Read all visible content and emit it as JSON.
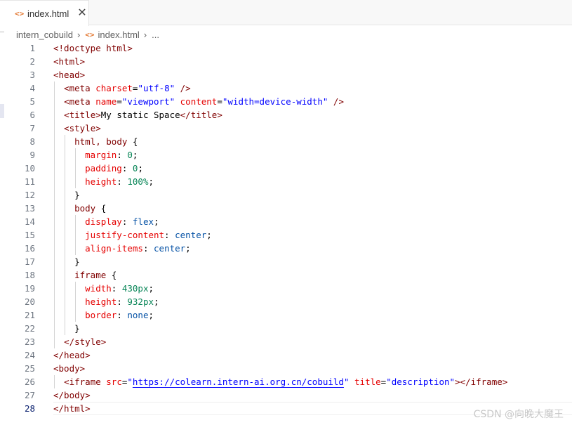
{
  "tab": {
    "icon": "<>",
    "label": "index.html",
    "close": "✕"
  },
  "breadcrumb": {
    "folder": "intern_cobuild",
    "separator": "›",
    "file_icon": "<>",
    "file": "index.html",
    "ellipsis": "..."
  },
  "editor": {
    "current_line": 28,
    "lines": [
      {
        "num": "1",
        "tokens": [
          [
            "tag",
            "<!doctype html>"
          ]
        ]
      },
      {
        "num": "2",
        "tokens": [
          [
            "tag",
            "<html>"
          ]
        ]
      },
      {
        "num": "3",
        "tokens": [
          [
            "tag",
            "<head>"
          ]
        ]
      },
      {
        "num": "4",
        "tokens": [
          [
            "txt",
            "  "
          ],
          [
            "tag",
            "<meta "
          ],
          [
            "attr",
            "charset"
          ],
          [
            "txt",
            "="
          ],
          [
            "str",
            "\"utf-8\""
          ],
          [
            "tag",
            " />"
          ]
        ]
      },
      {
        "num": "5",
        "tokens": [
          [
            "txt",
            "  "
          ],
          [
            "tag",
            "<meta "
          ],
          [
            "attr",
            "name"
          ],
          [
            "txt",
            "="
          ],
          [
            "str",
            "\"viewport\""
          ],
          [
            "txt",
            " "
          ],
          [
            "attr",
            "content"
          ],
          [
            "txt",
            "="
          ],
          [
            "str",
            "\"width=device-width\""
          ],
          [
            "tag",
            " />"
          ]
        ]
      },
      {
        "num": "6",
        "tokens": [
          [
            "txt",
            "  "
          ],
          [
            "tag",
            "<title>"
          ],
          [
            "txt",
            "My static Space"
          ],
          [
            "tag",
            "</title>"
          ]
        ]
      },
      {
        "num": "7",
        "tokens": [
          [
            "txt",
            "  "
          ],
          [
            "tag",
            "<style>"
          ]
        ]
      },
      {
        "num": "8",
        "tokens": [
          [
            "txt",
            "    "
          ],
          [
            "sel",
            "html, body "
          ],
          [
            "txt",
            "{"
          ]
        ]
      },
      {
        "num": "9",
        "tokens": [
          [
            "txt",
            "      "
          ],
          [
            "prop",
            "margin"
          ],
          [
            "txt",
            ": "
          ],
          [
            "num",
            "0"
          ],
          [
            "txt",
            ";"
          ]
        ]
      },
      {
        "num": "10",
        "tokens": [
          [
            "txt",
            "      "
          ],
          [
            "prop",
            "padding"
          ],
          [
            "txt",
            ": "
          ],
          [
            "num",
            "0"
          ],
          [
            "txt",
            ";"
          ]
        ]
      },
      {
        "num": "11",
        "tokens": [
          [
            "txt",
            "      "
          ],
          [
            "prop",
            "height"
          ],
          [
            "txt",
            ": "
          ],
          [
            "num",
            "100%"
          ],
          [
            "txt",
            ";"
          ]
        ]
      },
      {
        "num": "12",
        "tokens": [
          [
            "txt",
            "    "
          ],
          [
            "txt",
            "}"
          ]
        ]
      },
      {
        "num": "13",
        "tokens": [
          [
            "txt",
            "    "
          ],
          [
            "sel",
            "body "
          ],
          [
            "txt",
            "{"
          ]
        ]
      },
      {
        "num": "14",
        "tokens": [
          [
            "txt",
            "      "
          ],
          [
            "prop",
            "display"
          ],
          [
            "txt",
            ": "
          ],
          [
            "val",
            "flex"
          ],
          [
            "txt",
            ";"
          ]
        ]
      },
      {
        "num": "15",
        "tokens": [
          [
            "txt",
            "      "
          ],
          [
            "prop",
            "justify-content"
          ],
          [
            "txt",
            ": "
          ],
          [
            "val",
            "center"
          ],
          [
            "txt",
            ";"
          ]
        ]
      },
      {
        "num": "16",
        "tokens": [
          [
            "txt",
            "      "
          ],
          [
            "prop",
            "align-items"
          ],
          [
            "txt",
            ": "
          ],
          [
            "val",
            "center"
          ],
          [
            "txt",
            ";"
          ]
        ]
      },
      {
        "num": "17",
        "tokens": [
          [
            "txt",
            "    "
          ],
          [
            "txt",
            "}"
          ]
        ]
      },
      {
        "num": "18",
        "tokens": [
          [
            "txt",
            "    "
          ],
          [
            "sel",
            "iframe "
          ],
          [
            "txt",
            "{"
          ]
        ]
      },
      {
        "num": "19",
        "tokens": [
          [
            "txt",
            "      "
          ],
          [
            "prop",
            "width"
          ],
          [
            "txt",
            ": "
          ],
          [
            "num",
            "430px"
          ],
          [
            "txt",
            ";"
          ]
        ]
      },
      {
        "num": "20",
        "tokens": [
          [
            "txt",
            "      "
          ],
          [
            "prop",
            "height"
          ],
          [
            "txt",
            ": "
          ],
          [
            "num",
            "932px"
          ],
          [
            "txt",
            ";"
          ]
        ]
      },
      {
        "num": "21",
        "tokens": [
          [
            "txt",
            "      "
          ],
          [
            "prop",
            "border"
          ],
          [
            "txt",
            ": "
          ],
          [
            "val",
            "none"
          ],
          [
            "txt",
            ";"
          ]
        ]
      },
      {
        "num": "22",
        "tokens": [
          [
            "txt",
            "    "
          ],
          [
            "txt",
            "}"
          ]
        ]
      },
      {
        "num": "23",
        "tokens": [
          [
            "txt",
            "  "
          ],
          [
            "tag",
            "</style>"
          ]
        ]
      },
      {
        "num": "24",
        "tokens": [
          [
            "tag",
            "</head>"
          ]
        ]
      },
      {
        "num": "25",
        "tokens": [
          [
            "tag",
            "<body>"
          ]
        ]
      },
      {
        "num": "26",
        "tokens": [
          [
            "txt",
            "  "
          ],
          [
            "tag",
            "<iframe "
          ],
          [
            "attr",
            "src"
          ],
          [
            "txt",
            "="
          ],
          [
            "str",
            "\""
          ],
          [
            "link",
            "https://colearn.intern-ai.org.cn/cobuild"
          ],
          [
            "str",
            "\""
          ],
          [
            "txt",
            " "
          ],
          [
            "attr",
            "title"
          ],
          [
            "txt",
            "="
          ],
          [
            "str",
            "\"description\""
          ],
          [
            "tag",
            "></iframe>"
          ]
        ]
      },
      {
        "num": "27",
        "tokens": [
          [
            "tag",
            "</body>"
          ]
        ]
      },
      {
        "num": "28",
        "tokens": [
          [
            "tag",
            "</html>"
          ]
        ]
      }
    ]
  },
  "watermark": "CSDN @向晚大魔王"
}
